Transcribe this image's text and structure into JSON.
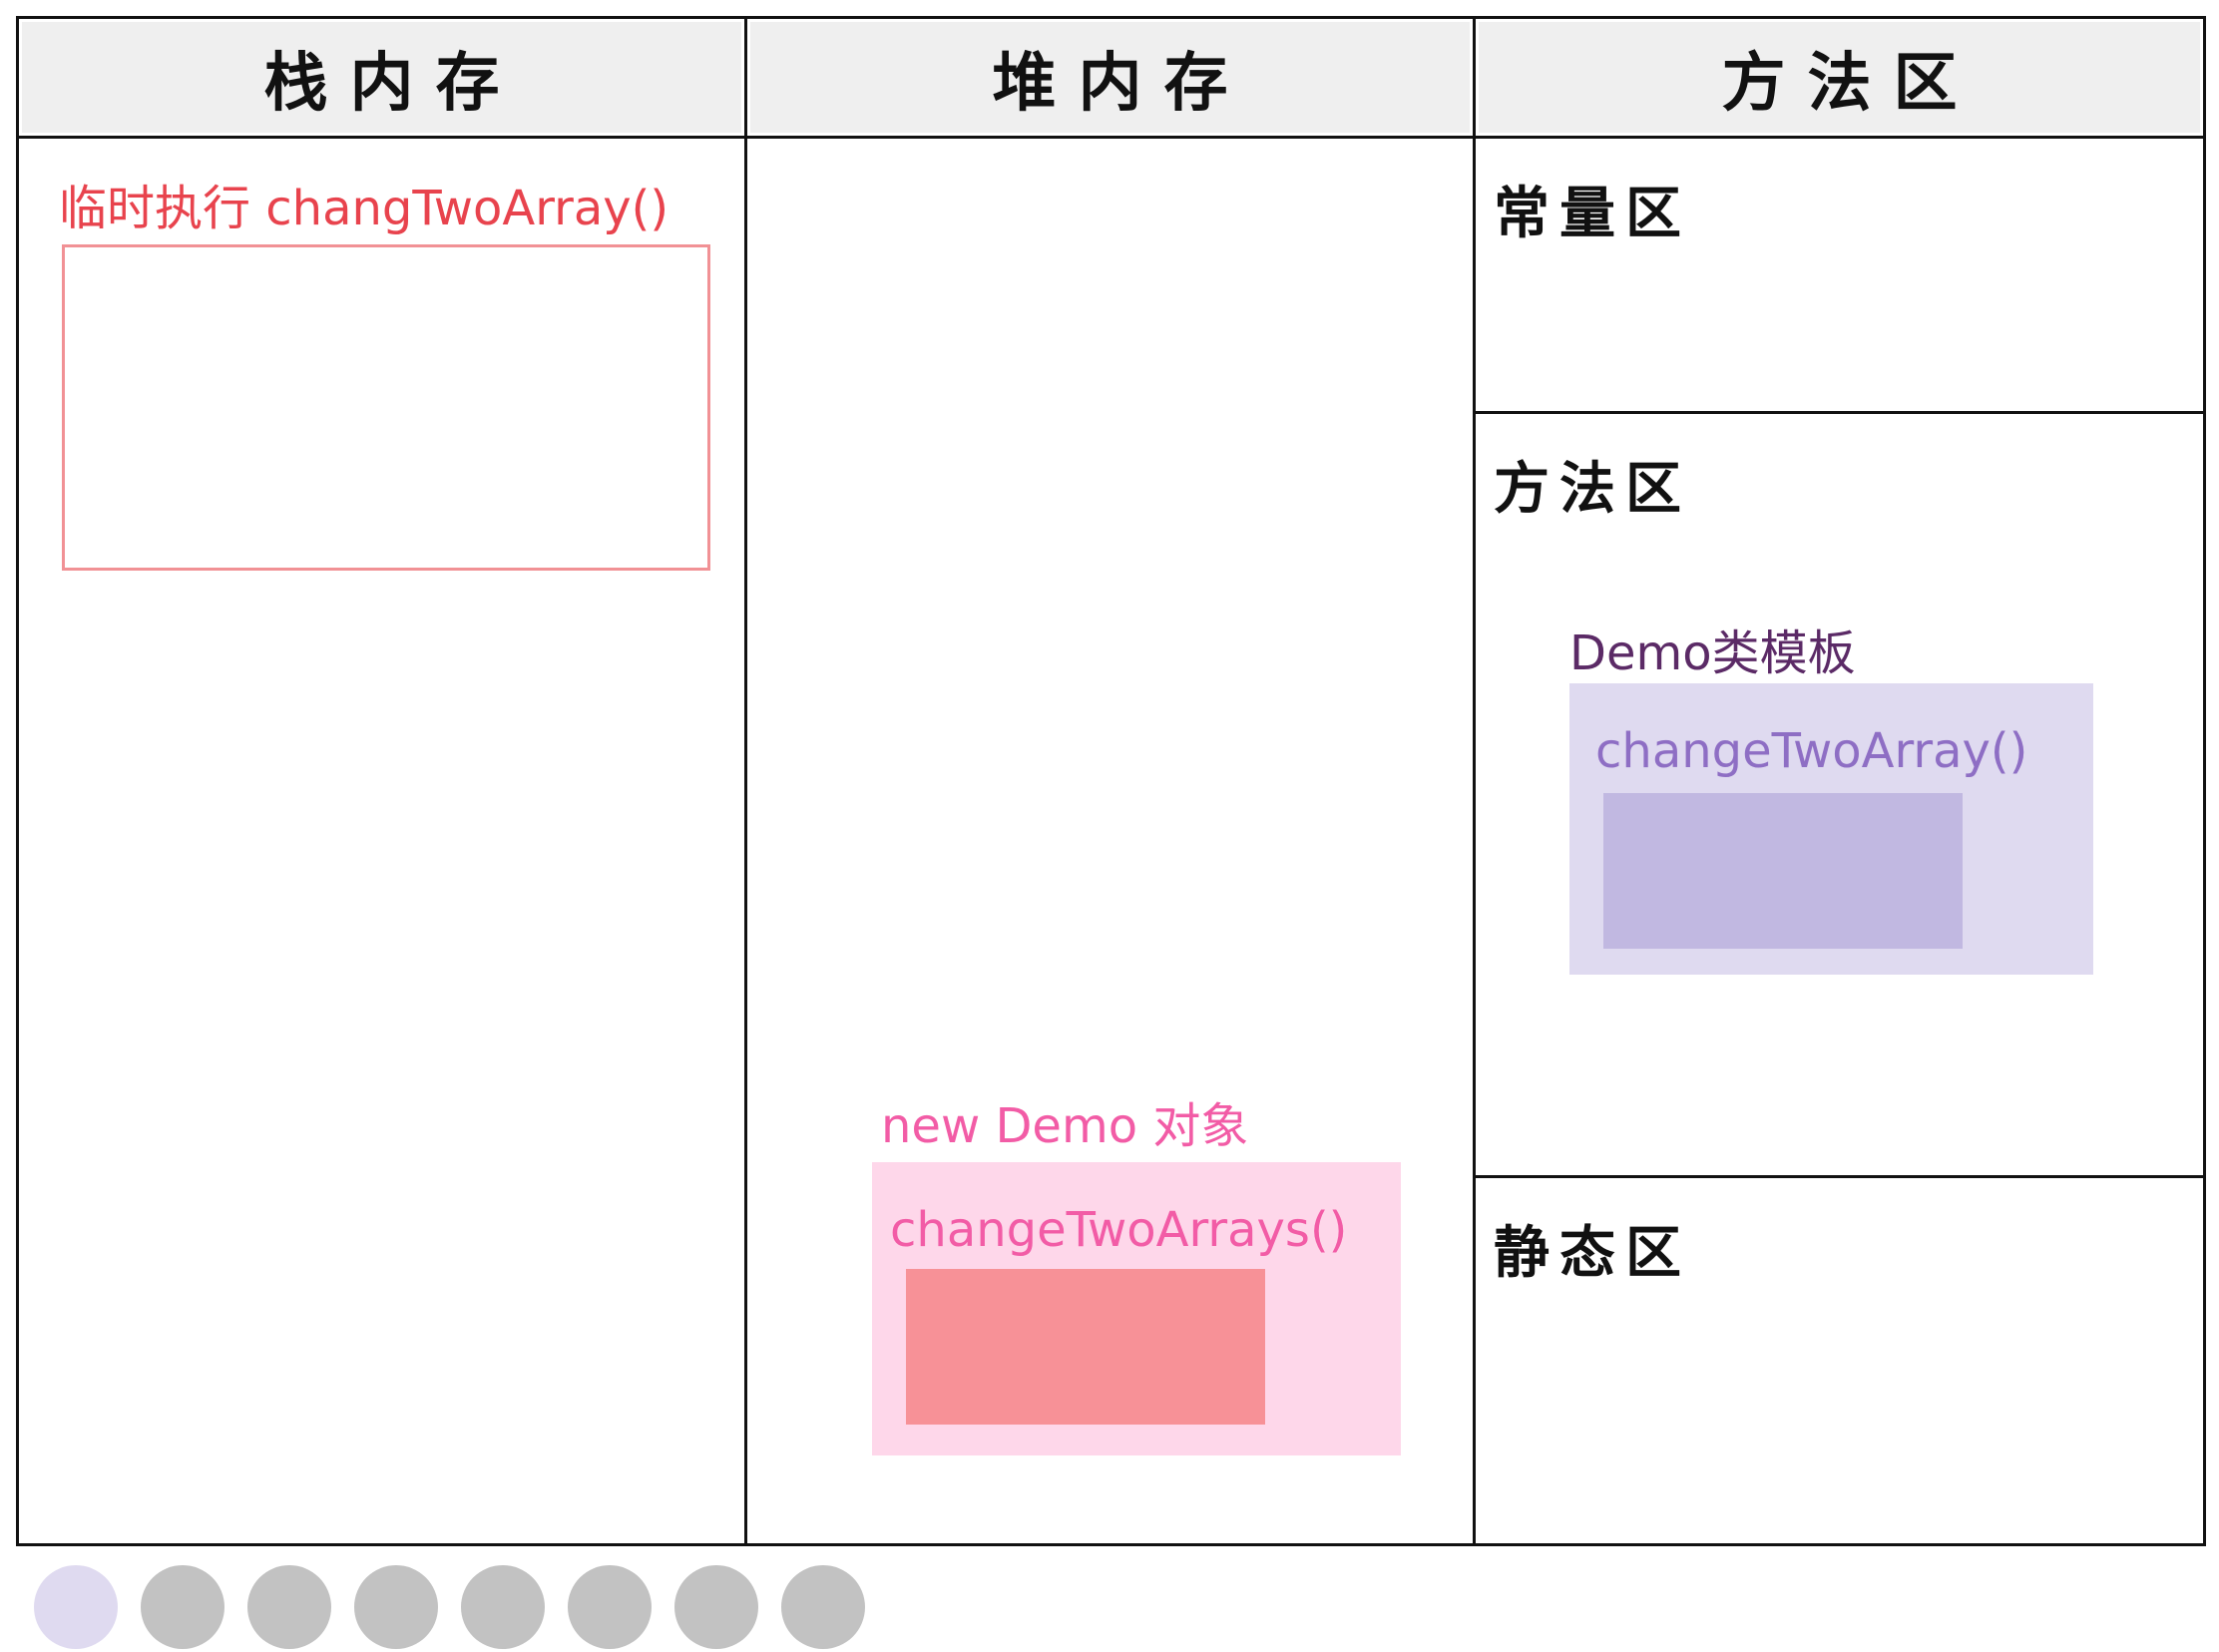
{
  "columns": {
    "stack": {
      "header": "栈内存",
      "frame_label": "临时执行 changTwoArray()"
    },
    "heap": {
      "header": "堆内存",
      "object_label": "new Demo 对象",
      "object_method_label": "changeTwoArrays()"
    },
    "method": {
      "header": "方法区",
      "sections": {
        "constant": {
          "title": "常量区"
        },
        "method_area": {
          "title": "方法区",
          "template_label": "Demo类模板",
          "template_method_label": "changeTwoArray()"
        },
        "static": {
          "title": "静态区"
        }
      }
    }
  },
  "pager": {
    "count": 8,
    "active_index": 0
  },
  "colors": {
    "stack_frame": "#e8434d",
    "heap_object": "#f25ca6",
    "heap_object_fill": "#fed7ea",
    "heap_method_block": "#f79197",
    "template_fill": "#dfdaf0",
    "template_method_block": "#c1b8e1",
    "template_label": "#5b2a66",
    "template_method_label": "#8e6ec4"
  }
}
